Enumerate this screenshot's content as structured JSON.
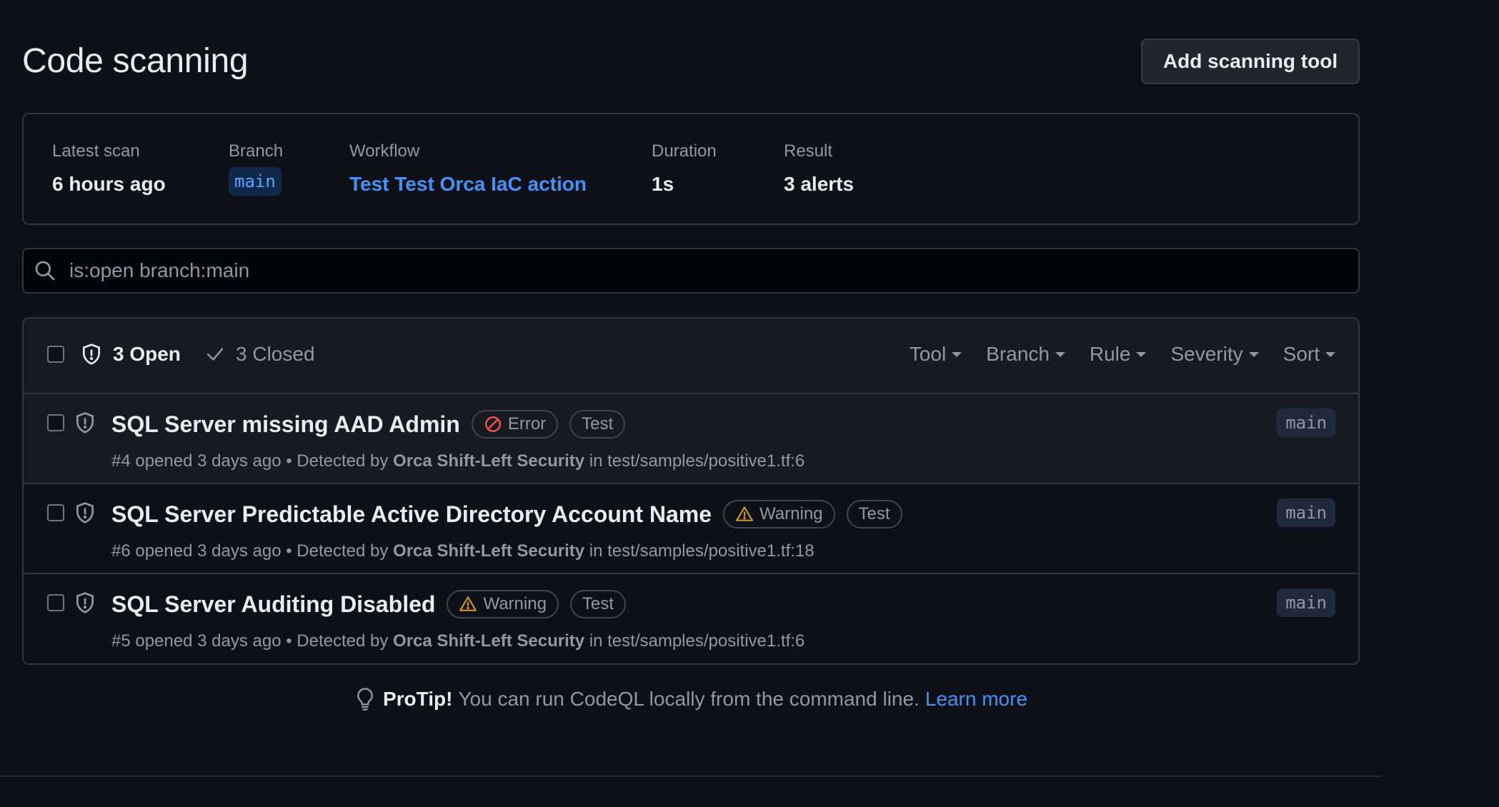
{
  "header": {
    "title": "Code scanning",
    "add_button_label": "Add scanning tool"
  },
  "summary": {
    "latest_scan_label": "Latest scan",
    "latest_scan_value": "6 hours ago",
    "branch_label": "Branch",
    "branch_value": "main",
    "workflow_label": "Workflow",
    "workflow_value": "Test Test Orca IaC action",
    "duration_label": "Duration",
    "duration_value": "1s",
    "result_label": "Result",
    "result_value": "3 alerts"
  },
  "search": {
    "value": "is:open branch:main",
    "icon": "search-icon"
  },
  "alerts_header": {
    "open_label": "3 Open",
    "closed_label": "3 Closed",
    "filters": [
      "Tool",
      "Branch",
      "Rule",
      "Severity",
      "Sort"
    ]
  },
  "alerts": [
    {
      "title": "SQL Server missing AAD Admin",
      "severity": "Error",
      "severity_icon": "error-stop-icon",
      "tag": "Test",
      "number_opened": "#4 opened 3 days ago",
      "detected_prefix": "• Detected by",
      "tool": "Orca Shift-Left Security",
      "location_prefix": "in",
      "location": "test/samples/positive1.tf:6",
      "branch": "main"
    },
    {
      "title": "SQL Server Predictable Active Directory Account Name",
      "severity": "Warning",
      "severity_icon": "warning-icon",
      "tag": "Test",
      "number_opened": "#6 opened 3 days ago",
      "detected_prefix": "• Detected by",
      "tool": "Orca Shift-Left Security",
      "location_prefix": "in",
      "location": "test/samples/positive1.tf:18",
      "branch": "main"
    },
    {
      "title": "SQL Server Auditing Disabled",
      "severity": "Warning",
      "severity_icon": "warning-icon",
      "tag": "Test",
      "number_opened": "#5 opened 3 days ago",
      "detected_prefix": "• Detected by",
      "tool": "Orca Shift-Left Security",
      "location_prefix": "in",
      "location": "test/samples/positive1.tf:6",
      "branch": "main"
    }
  ],
  "protip": {
    "label": "ProTip!",
    "text": "You can run CodeQL locally from the command line.",
    "link": "Learn more"
  },
  "colors": {
    "background": "#0d1117",
    "link": "#4493f8",
    "error": "#f85149",
    "warning": "#d29922"
  }
}
